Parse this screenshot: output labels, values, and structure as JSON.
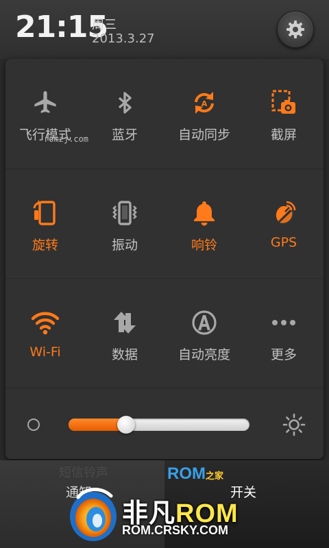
{
  "status_header": {
    "time": "21:15",
    "weekday": "周三",
    "date": "2013.3.27",
    "settings_icon": "gear-icon"
  },
  "colors": {
    "accent": "#ff7a1a",
    "inactive": "#b8b8b8",
    "panel": "#313131"
  },
  "toggles": [
    {
      "label": "飞行模式",
      "icon": "airplane-icon",
      "on": false
    },
    {
      "label": "蓝牙",
      "icon": "bluetooth-icon",
      "on": false
    },
    {
      "label": "自动同步",
      "icon": "sync-icon",
      "on": false
    },
    {
      "label": "截屏",
      "icon": "screenshot-icon",
      "on": false
    },
    {
      "label": "旋转",
      "icon": "rotate-icon",
      "on": true
    },
    {
      "label": "振动",
      "icon": "vibrate-icon",
      "on": false
    },
    {
      "label": "响铃",
      "icon": "bell-icon",
      "on": true
    },
    {
      "label": "GPS",
      "icon": "gps-icon",
      "on": true
    },
    {
      "label": "Wi-Fi",
      "icon": "wifi-icon",
      "on": true
    },
    {
      "label": "数据",
      "icon": "data-icon",
      "on": false
    },
    {
      "label": "自动亮度",
      "icon": "auto-brightness-icon",
      "on": false
    },
    {
      "label": "更多",
      "icon": "more-icon",
      "on": false
    }
  ],
  "watermark": "romzj.com",
  "brightness": {
    "level": 0.32,
    "low_icon": "dim-icon",
    "high_icon": "sun-icon"
  },
  "tabs": {
    "notifications_label": "通知",
    "toggles_label": "开关",
    "ghost_text": "短信铃声"
  },
  "branding": {
    "rom_home_latin": "ROM",
    "rom_home_zh": "之家",
    "logo_cn": "非凡",
    "logo_rom": "ROM",
    "logo_url": "ROM.CRSKY.COM"
  }
}
